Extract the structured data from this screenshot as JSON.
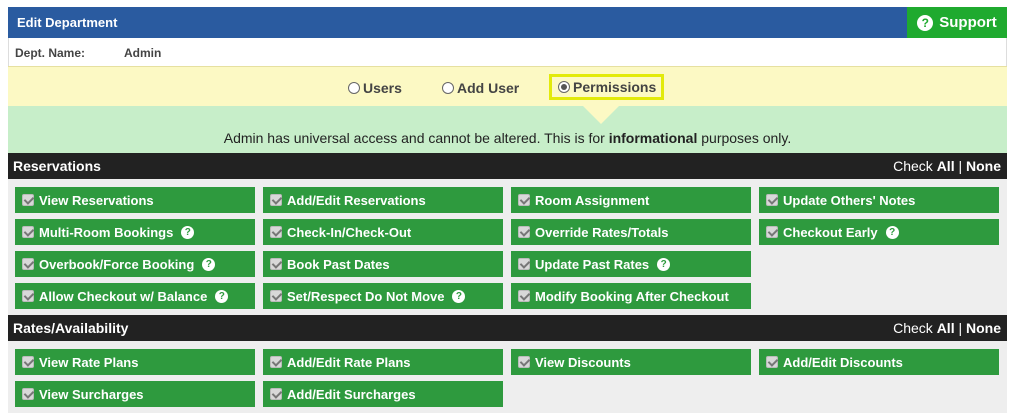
{
  "header": {
    "title": "Edit Department",
    "support_label": "Support",
    "support_icon": "?"
  },
  "dept": {
    "label": "Dept. Name:",
    "value": "Admin"
  },
  "tabs": [
    {
      "label": "Users",
      "selected": false
    },
    {
      "label": "Add User",
      "selected": false
    },
    {
      "label": "Permissions",
      "selected": true
    }
  ],
  "info": {
    "prefix": "Admin has universal access and cannot be altered. This is for ",
    "bold": "informational",
    "suffix": " purposes only."
  },
  "check_controls": {
    "prefix": "Check ",
    "all": "All",
    "sep": " | ",
    "none": "None"
  },
  "hint_glyph": "?",
  "sections": [
    {
      "title": "Reservations",
      "items": [
        {
          "label": "View Reservations",
          "hint": false
        },
        {
          "label": "Add/Edit Reservations",
          "hint": false
        },
        {
          "label": "Room Assignment",
          "hint": false
        },
        {
          "label": "Update Others' Notes",
          "hint": false
        },
        {
          "label": "Multi-Room Bookings",
          "hint": true
        },
        {
          "label": "Check-In/Check-Out",
          "hint": false
        },
        {
          "label": "Override Rates/Totals",
          "hint": false
        },
        {
          "label": "Checkout Early",
          "hint": true
        },
        {
          "label": "Overbook/Force Booking",
          "hint": true
        },
        {
          "label": "Book Past Dates",
          "hint": false
        },
        {
          "label": "Update Past Rates",
          "hint": true
        },
        {
          "label": "Allow Checkout w/ Balance",
          "hint": true
        },
        {
          "label": "Set/Respect Do Not Move",
          "hint": true
        },
        {
          "label": "Modify Booking After Checkout",
          "hint": false
        }
      ]
    },
    {
      "title": "Rates/Availability",
      "items": [
        {
          "label": "View Rate Plans",
          "hint": false
        },
        {
          "label": "Add/Edit Rate Plans",
          "hint": false
        },
        {
          "label": "View Discounts",
          "hint": false
        },
        {
          "label": "Add/Edit Discounts",
          "hint": false
        },
        {
          "label": "View Surcharges",
          "hint": false
        },
        {
          "label": "Add/Edit Surcharges",
          "hint": false
        }
      ]
    }
  ],
  "colors": {
    "header_blue": "#2a5ba0",
    "support_green": "#1faa2f",
    "perm_green": "#2e9a3e",
    "tabs_yellow": "#fcf9c4",
    "info_green": "#c7eec9",
    "section_dark": "#222222",
    "highlight": "#e2ea0a"
  }
}
